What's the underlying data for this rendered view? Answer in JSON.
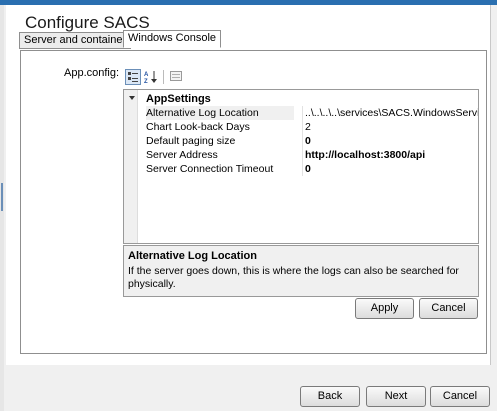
{
  "dialog": {
    "title": "Configure SACS",
    "tabs": [
      {
        "label": "Server and container",
        "selected": false
      },
      {
        "label": "Windows Console",
        "selected": true
      }
    ]
  },
  "config": {
    "label": "App.config:",
    "toolbar": [
      "categorized-icon",
      "alphabetical-sort-icon",
      "property-pages-icon"
    ],
    "category": "AppSettings",
    "properties": [
      {
        "name": "Alternative Log Location",
        "value": "..\\..\\..\\..\\services\\SACS.WindowsService\\bin",
        "selected": true
      },
      {
        "name": "Chart Look-back Days",
        "value": "2"
      },
      {
        "name": "Default paging size",
        "value": "0"
      },
      {
        "name": "Server Address",
        "value": "http://localhost:3800/api"
      },
      {
        "name": "Server Connection Timeout",
        "value": "0"
      }
    ],
    "description": {
      "title": "Alternative Log Location",
      "text": "If the server goes down, this is where the logs can also be searched for physically."
    }
  },
  "buttons": {
    "apply": "Apply",
    "cancel_inner": "Cancel",
    "back": "Back",
    "next": "Next",
    "cancel": "Cancel"
  },
  "colors": {
    "accent": "#2a6fb0",
    "selection": "#dbe7f5"
  }
}
